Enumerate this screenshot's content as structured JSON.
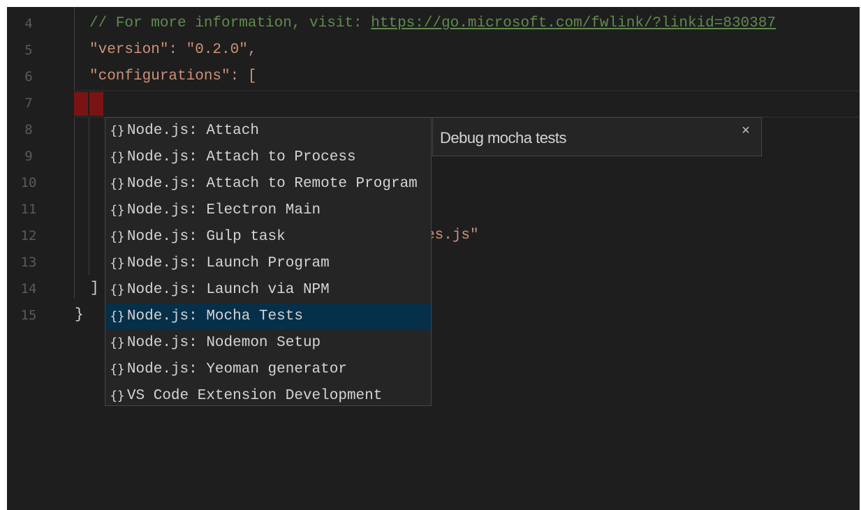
{
  "editor": {
    "lines": [
      {
        "num": "4",
        "text": "// For more information, visit: ",
        "link": "https://go.microsoft.com/fwlink/?linkid=830387"
      },
      {
        "num": "5",
        "text": "\"version\": \"0.2.0\","
      },
      {
        "num": "6",
        "text": "\"configurations\": ["
      },
      {
        "num": "7",
        "text": ""
      },
      {
        "num": "8",
        "text": ""
      },
      {
        "num": "9",
        "text": ""
      },
      {
        "num": "10",
        "text": ""
      },
      {
        "num": "11",
        "text": ""
      },
      {
        "num": "12",
        "text": "es.js\""
      },
      {
        "num": "13",
        "text": ""
      },
      {
        "num": "14",
        "text": "]"
      },
      {
        "num": "15",
        "text": "}"
      }
    ]
  },
  "suggest": {
    "icon": "braces-icon",
    "icon_glyph": "{}",
    "items": [
      "Node.js: Attach",
      "Node.js: Attach to Process",
      "Node.js: Attach to Remote Program",
      "Node.js: Electron Main",
      "Node.js: Gulp task",
      "Node.js: Launch Program",
      "Node.js: Launch via NPM",
      "Node.js: Mocha Tests",
      "Node.js: Nodemon Setup",
      "Node.js: Yeoman generator",
      "VS Code Extension Development"
    ],
    "selected_index": 7
  },
  "details": {
    "text": "Debug mocha tests",
    "close_glyph": "×"
  },
  "colors": {
    "background": "#1e1e1e",
    "comment": "#608b4e",
    "string": "#ce9178",
    "selection": "#062f4a",
    "error": "#7a1414"
  }
}
